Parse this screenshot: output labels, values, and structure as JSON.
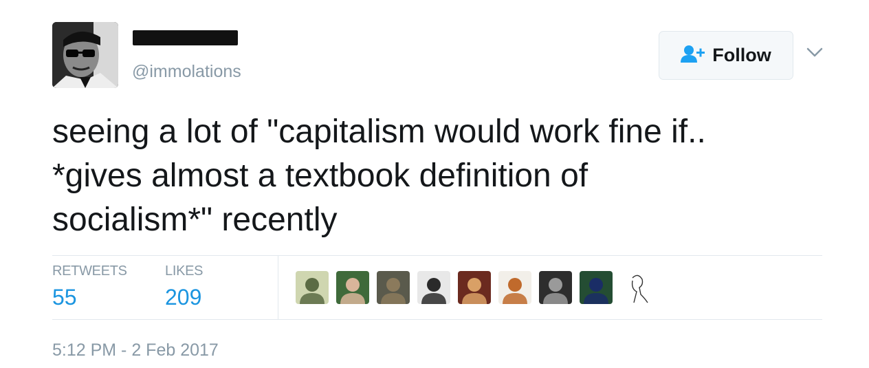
{
  "tweet": {
    "handle": "@immolations",
    "text_lines": [
      "seeing a lot of \"capitalism would work fine if..",
      "*gives almost a textbook definition of",
      "socialism*\" recently"
    ],
    "timestamp": "5:12 PM - 2 Feb 2017"
  },
  "follow_button": {
    "label": "Follow",
    "icon": "add-user-icon"
  },
  "stats": {
    "retweets": {
      "label": "RETWEETS",
      "value": "55"
    },
    "likes": {
      "label": "LIKES",
      "value": "209"
    }
  },
  "likers": [
    {
      "name": "liker-avatar-1",
      "colors": [
        "#cfd6b0",
        "#5b6b44"
      ]
    },
    {
      "name": "liker-avatar-2",
      "colors": [
        "#3f6a3a",
        "#d9b59a"
      ]
    },
    {
      "name": "liker-avatar-3",
      "colors": [
        "#5a5a4c",
        "#8b7a5c"
      ]
    },
    {
      "name": "liker-avatar-4",
      "colors": [
        "#e8e8e8",
        "#2a2a2a"
      ]
    },
    {
      "name": "liker-avatar-5",
      "colors": [
        "#6b2a1f",
        "#d9a066"
      ]
    },
    {
      "name": "liker-avatar-6",
      "colors": [
        "#f2efe9",
        "#c06a2c"
      ]
    },
    {
      "name": "liker-avatar-7",
      "colors": [
        "#2d2d2d",
        "#9a9a9a"
      ]
    },
    {
      "name": "liker-avatar-8",
      "colors": [
        "#244d33",
        "#1a2d66"
      ]
    },
    {
      "name": "liker-avatar-9",
      "colors": [
        "#ffffff",
        "#333333"
      ]
    }
  ],
  "colors": {
    "accent": "#1b95e0",
    "muted": "#8899a6",
    "text": "#14171a",
    "border": "#e1e8ed"
  }
}
